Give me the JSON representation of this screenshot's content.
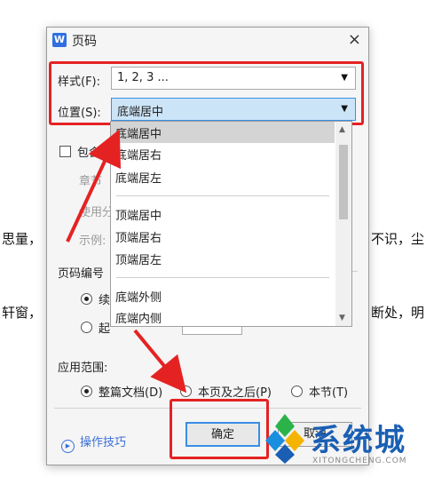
{
  "background": {
    "left_1": "思量，",
    "left_2": "轩窗，",
    "right_1": "不识，尘",
    "right_2": "断处，明"
  },
  "dialog": {
    "app_icon": "W",
    "title": "页码",
    "close": "×",
    "style_label": "样式(F):",
    "style_value": "1, 2, 3 ...",
    "position_label": "位置(S):",
    "position_value": "底端居中",
    "include_label": "包含章",
    "chapter_label": "章节",
    "use_label": "使用分",
    "example_label": "示例:",
    "numbering_section": "页码编号",
    "continue_label": "续",
    "start_label": "起",
    "start_value": "",
    "scope_section": "应用范围:",
    "scope_options": [
      "整篇文档(D)",
      "本页及之后(P)",
      "本节(T)"
    ],
    "tips": "操作技巧",
    "ok": "确定",
    "cancel": "取消"
  },
  "dropdown": {
    "items": [
      "底端居中",
      "底端居右",
      "底端居左",
      "顶端居中",
      "顶端居右",
      "顶端居左",
      "底端外侧",
      "底端内侧"
    ],
    "selected_index": 0
  },
  "watermark": {
    "text": "系统城",
    "url": "XITONGCHENG.COM"
  },
  "colors": {
    "highlight_red": "#e52222",
    "accent_blue": "#3a8ee6"
  }
}
